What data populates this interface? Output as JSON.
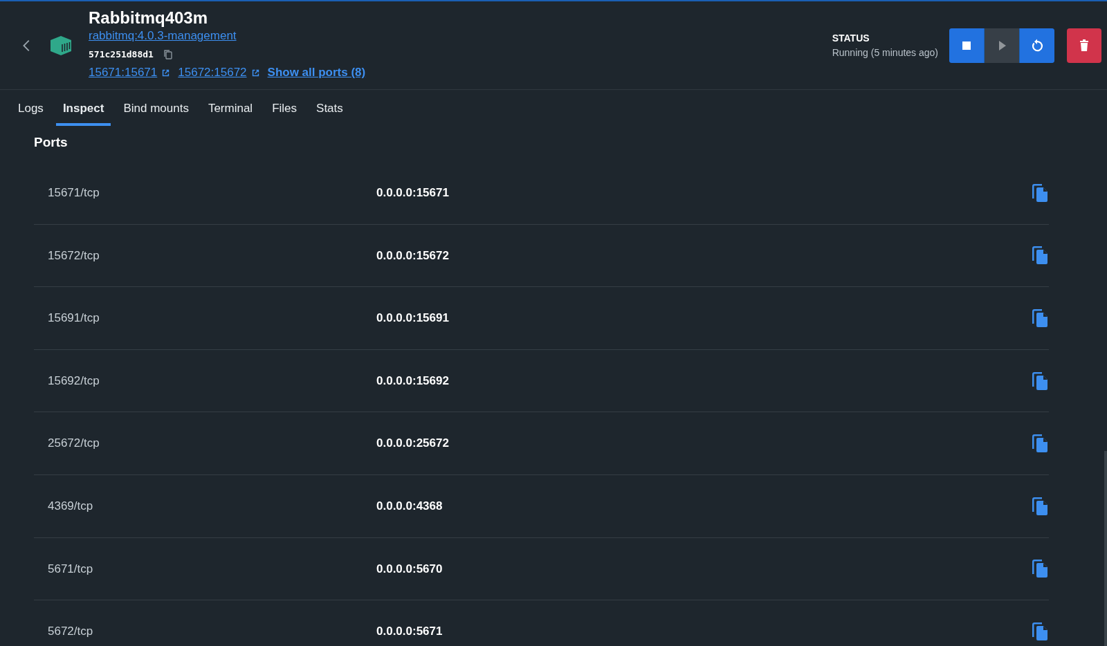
{
  "container": {
    "name": "Rabbitmq403m",
    "image": "rabbitmq:4.0.3-management",
    "id": "571c251d88d1",
    "port_links": [
      "15671:15671",
      "15672:15672"
    ],
    "show_all_ports": "Show all ports (8)"
  },
  "status": {
    "label": "STATUS",
    "value": "Running (5 minutes ago)"
  },
  "actions": [
    {
      "kind": "stop",
      "disabled": false
    },
    {
      "kind": "start",
      "disabled": true
    },
    {
      "kind": "restart",
      "disabled": false
    },
    {
      "kind": "delete",
      "disabled": false
    }
  ],
  "tabs": [
    {
      "label": "Logs",
      "selected": false
    },
    {
      "label": "Inspect",
      "selected": true
    },
    {
      "label": "Bind mounts",
      "selected": false
    },
    {
      "label": "Terminal",
      "selected": false
    },
    {
      "label": "Files",
      "selected": false
    },
    {
      "label": "Stats",
      "selected": false
    }
  ],
  "ports": {
    "title": "Ports",
    "rows": [
      {
        "port": "15671/tcp",
        "host": "0.0.0.0:15671"
      },
      {
        "port": "15672/tcp",
        "host": "0.0.0.0:15672"
      },
      {
        "port": "15691/tcp",
        "host": "0.0.0.0:15691"
      },
      {
        "port": "15692/tcp",
        "host": "0.0.0.0:15692"
      },
      {
        "port": "25672/tcp",
        "host": "0.0.0.0:25672"
      },
      {
        "port": "4369/tcp",
        "host": "0.0.0.0:4368"
      },
      {
        "port": "5671/tcp",
        "host": "0.0.0.0:5670"
      },
      {
        "port": "5672/tcp",
        "host": "0.0.0.0:5671"
      }
    ]
  }
}
